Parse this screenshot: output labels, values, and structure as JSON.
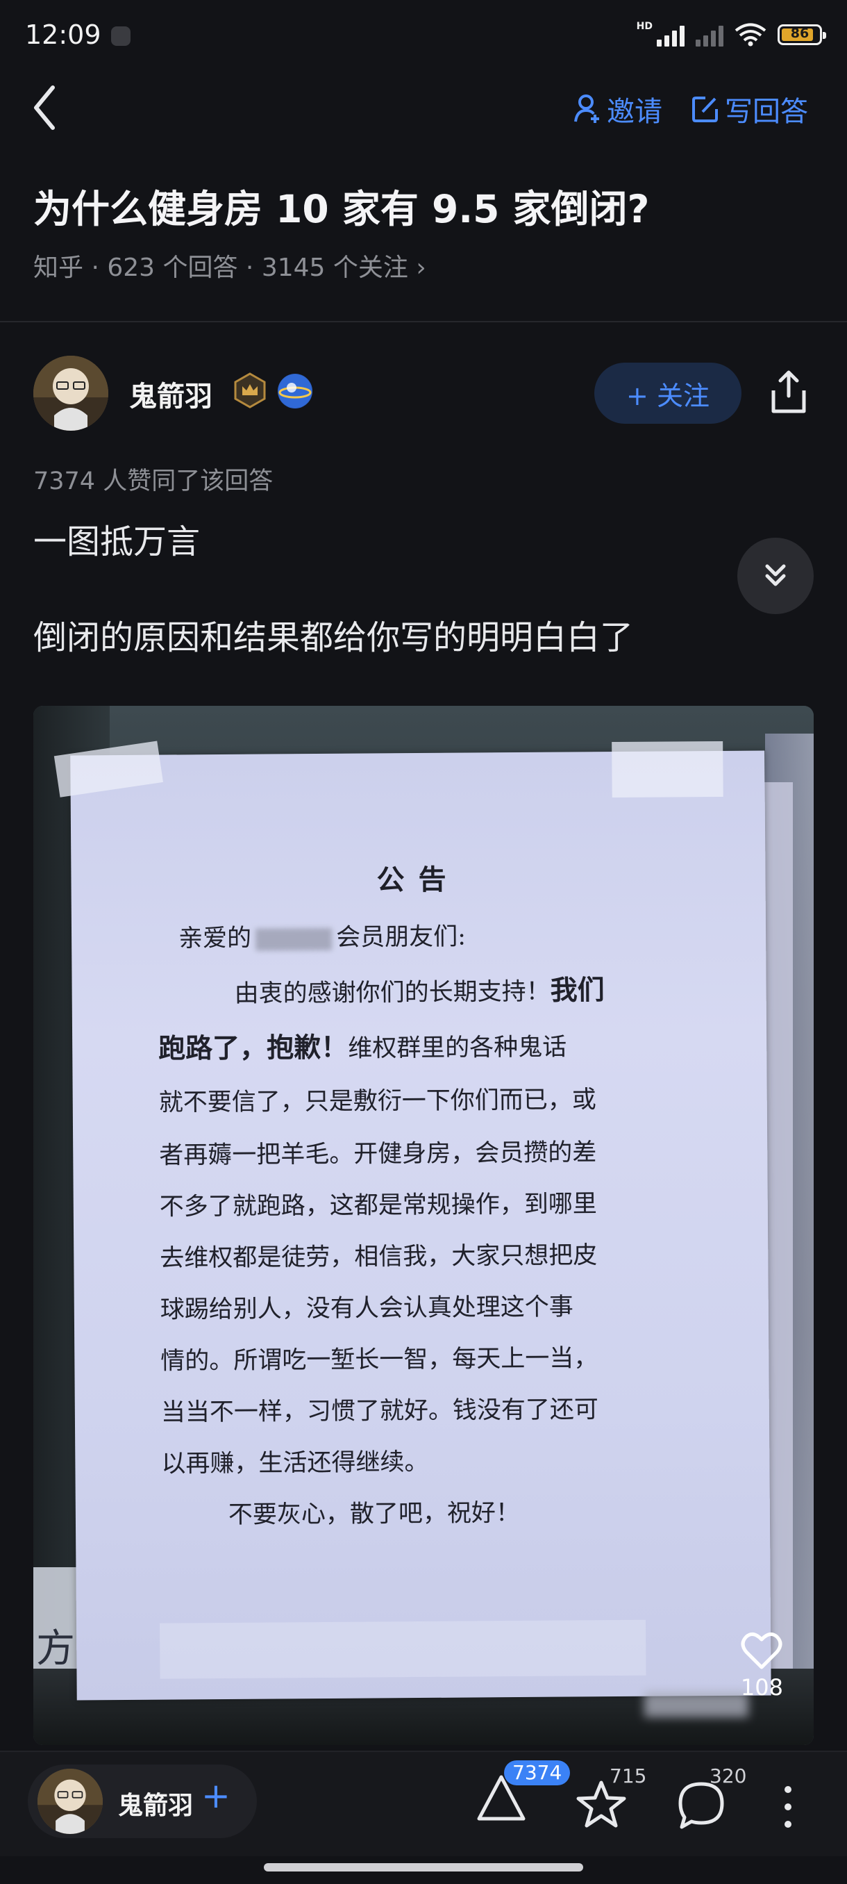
{
  "status_bar": {
    "time": "12:09",
    "network_label": "HD",
    "battery_level": 86,
    "battery_text": "86"
  },
  "header": {
    "invite_label": "邀请",
    "write_answer_label": "写回答"
  },
  "question": {
    "title": "为什么健身房 10 家有 9.5 家倒闭?",
    "meta": "知乎 · 623 个回答 · 3145 个关注 ›"
  },
  "author": {
    "name": "鬼箭羽",
    "follow_label": "+ 关注"
  },
  "answer": {
    "upvote_summary": "7374 人赞同了该回答",
    "line1": "一图抵万言",
    "line2": "倒闭的原因和结果都给你写的明明白白了"
  },
  "image": {
    "notice_title": "公告",
    "notice_greeting_pre": "亲爱的",
    "notice_greeting_post": "会员朋友们:",
    "notice_line1_normal": "由衷的感谢你们的长期支持！",
    "notice_line1_bold": "我们",
    "notice_line2_bold": "跑路了，抱歉！",
    "notice_line2_normal": "维权群里的各种鬼话",
    "notice_line3": "就不要信了，只是敷衍一下你们而已，或",
    "notice_line4": "者再薅一把羊毛。开健身房，会员攒的差",
    "notice_line5": "不多了就跑路，这都是常规操作，到哪里",
    "notice_line6": "去维权都是徒劳，相信我，大家只想把皮",
    "notice_line7": "球踢给别人，没有人会认真处理这个事",
    "notice_line8": "情的。所谓吃一堑长一智，每天上一当，",
    "notice_line9": "当当不一样，习惯了就好。钱没有了还可",
    "notice_line10": "以再赚，生活还得继续。",
    "notice_line11": "不要灰心，散了吧，祝好！",
    "side_sign_text": "方",
    "like_count": "108"
  },
  "bottom_bar": {
    "author_name": "鬼箭羽",
    "follow_plus": "+",
    "upvote_count": "7374",
    "favorite_count": "715",
    "comment_count": "320"
  },
  "colors": {
    "background": "#121317",
    "accent": "#4c8cff",
    "battery": "#e0a52a"
  }
}
